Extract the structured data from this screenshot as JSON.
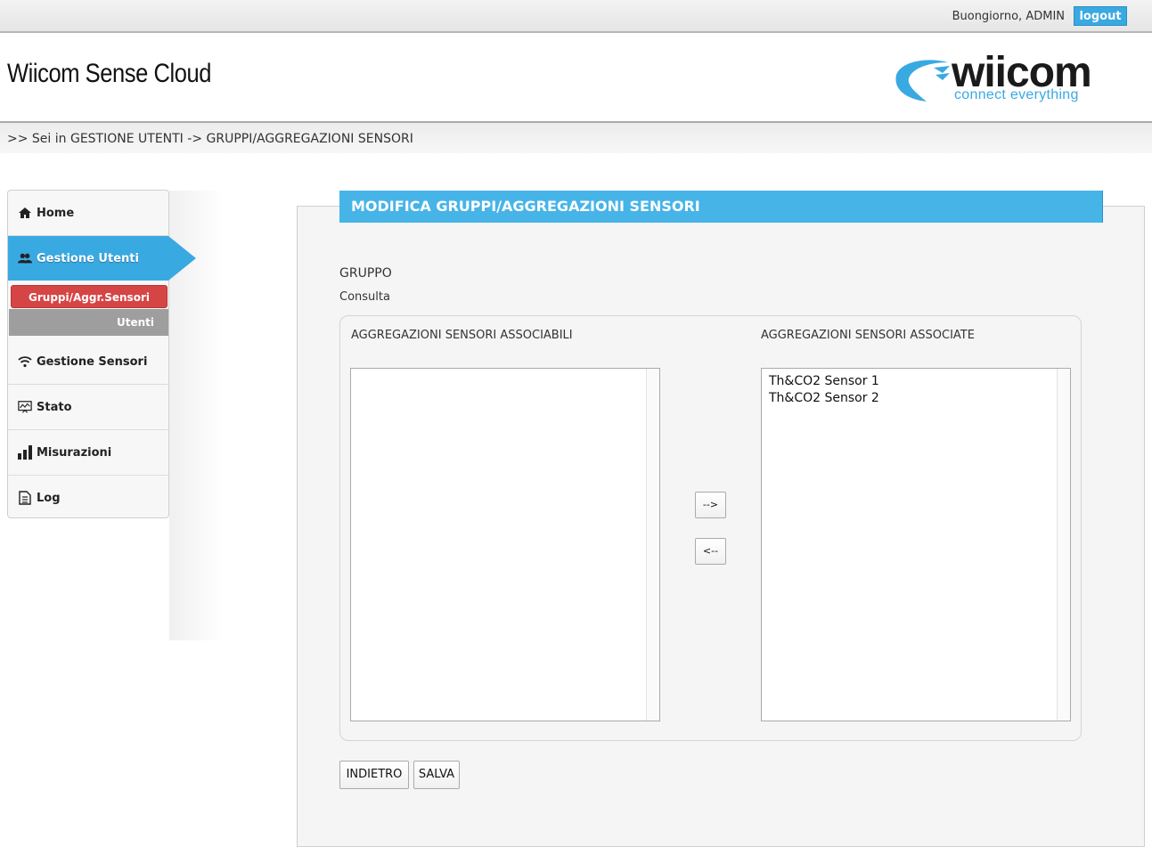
{
  "header": {
    "greeting": "Buongiorno,  ADMIN",
    "logout_label": "logout",
    "app_title": "Wiicom Sense Cloud",
    "logo_text": "wiicom",
    "logo_tagline": "connect everything"
  },
  "breadcrumb": ">> Sei in GESTIONE UTENTI -> GRUPPI/AGGREGAZIONI SENSORI",
  "sidebar": {
    "items": [
      {
        "label": "Home",
        "icon": "home-icon"
      },
      {
        "label": "Gestione Utenti",
        "icon": "users-icon"
      },
      {
        "label": "Gestione Sensori",
        "icon": "wifi-icon"
      },
      {
        "label": "Stato",
        "icon": "monitor-chart-icon"
      },
      {
        "label": "Misurazioni",
        "icon": "bar-chart-icon"
      },
      {
        "label": "Log",
        "icon": "document-icon"
      }
    ],
    "subitems": [
      "Gruppi/Aggr.Sensori",
      "Utenti"
    ]
  },
  "main": {
    "title": "MODIFICA GRUPPI/AGGREGAZIONI SENSORI",
    "group_label": "GRUPPO",
    "group_value": "Consulta",
    "available_label": "AGGREGAZIONI SENSORI ASSOCIABILI",
    "associated_label": "AGGREGAZIONI SENSORI ASSOCIATE",
    "available_items": [],
    "associated_items": [
      "Th&CO2 Sensor 1",
      "Th&CO2 Sensor 2"
    ],
    "move_right_label": "-->",
    "move_left_label": "<--",
    "back_label": "INDIETRO",
    "save_label": "SALVA"
  },
  "colors": {
    "accent": "#47b4e8",
    "active_subitem": "#d64545",
    "inactive_subitem": "#9e9e9e"
  }
}
